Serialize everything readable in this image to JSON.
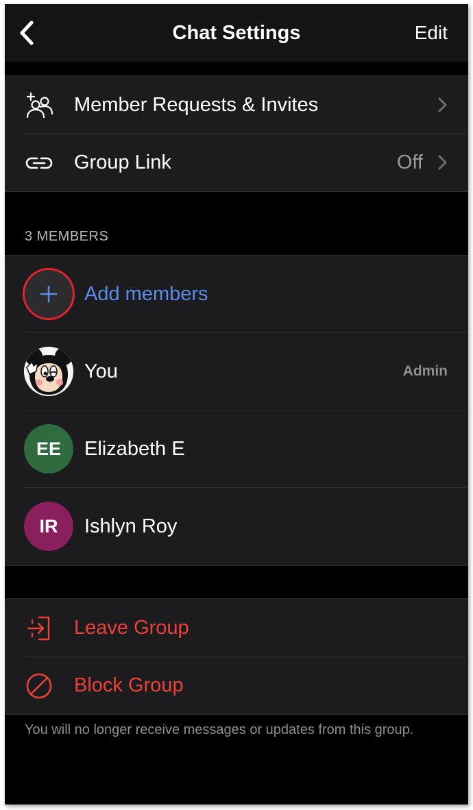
{
  "nav": {
    "title": "Chat Settings",
    "edit_label": "Edit",
    "back_icon": "chevron-left-icon"
  },
  "group_options": [
    {
      "label": "Member Requests & Invites",
      "icon": "add-person-group-icon",
      "value": ""
    },
    {
      "label": "Group Link",
      "icon": "link-icon",
      "value": "Off"
    }
  ],
  "members": {
    "header": "3 MEMBERS",
    "add_label": "Add members",
    "list": [
      {
        "name": "You",
        "initials": "",
        "role": "Admin",
        "avatar_color": "#ffffff"
      },
      {
        "name": "Elizabeth E",
        "initials": "EE",
        "role": "",
        "avatar_color": "#2f6b3f"
      },
      {
        "name": "Ishlyn Roy",
        "initials": "IR",
        "role": "",
        "avatar_color": "#8a1f5e"
      }
    ]
  },
  "actions": {
    "leave_label": "Leave Group",
    "block_label": "Block Group"
  },
  "footnote": "You will no longer receive messages or updates from this group.",
  "colors": {
    "background": "#000000",
    "cell": "#1c1c1e",
    "accent_blue": "#5a8de9",
    "destructive": "#eb4137",
    "highlight_ring": "#e0242a"
  }
}
